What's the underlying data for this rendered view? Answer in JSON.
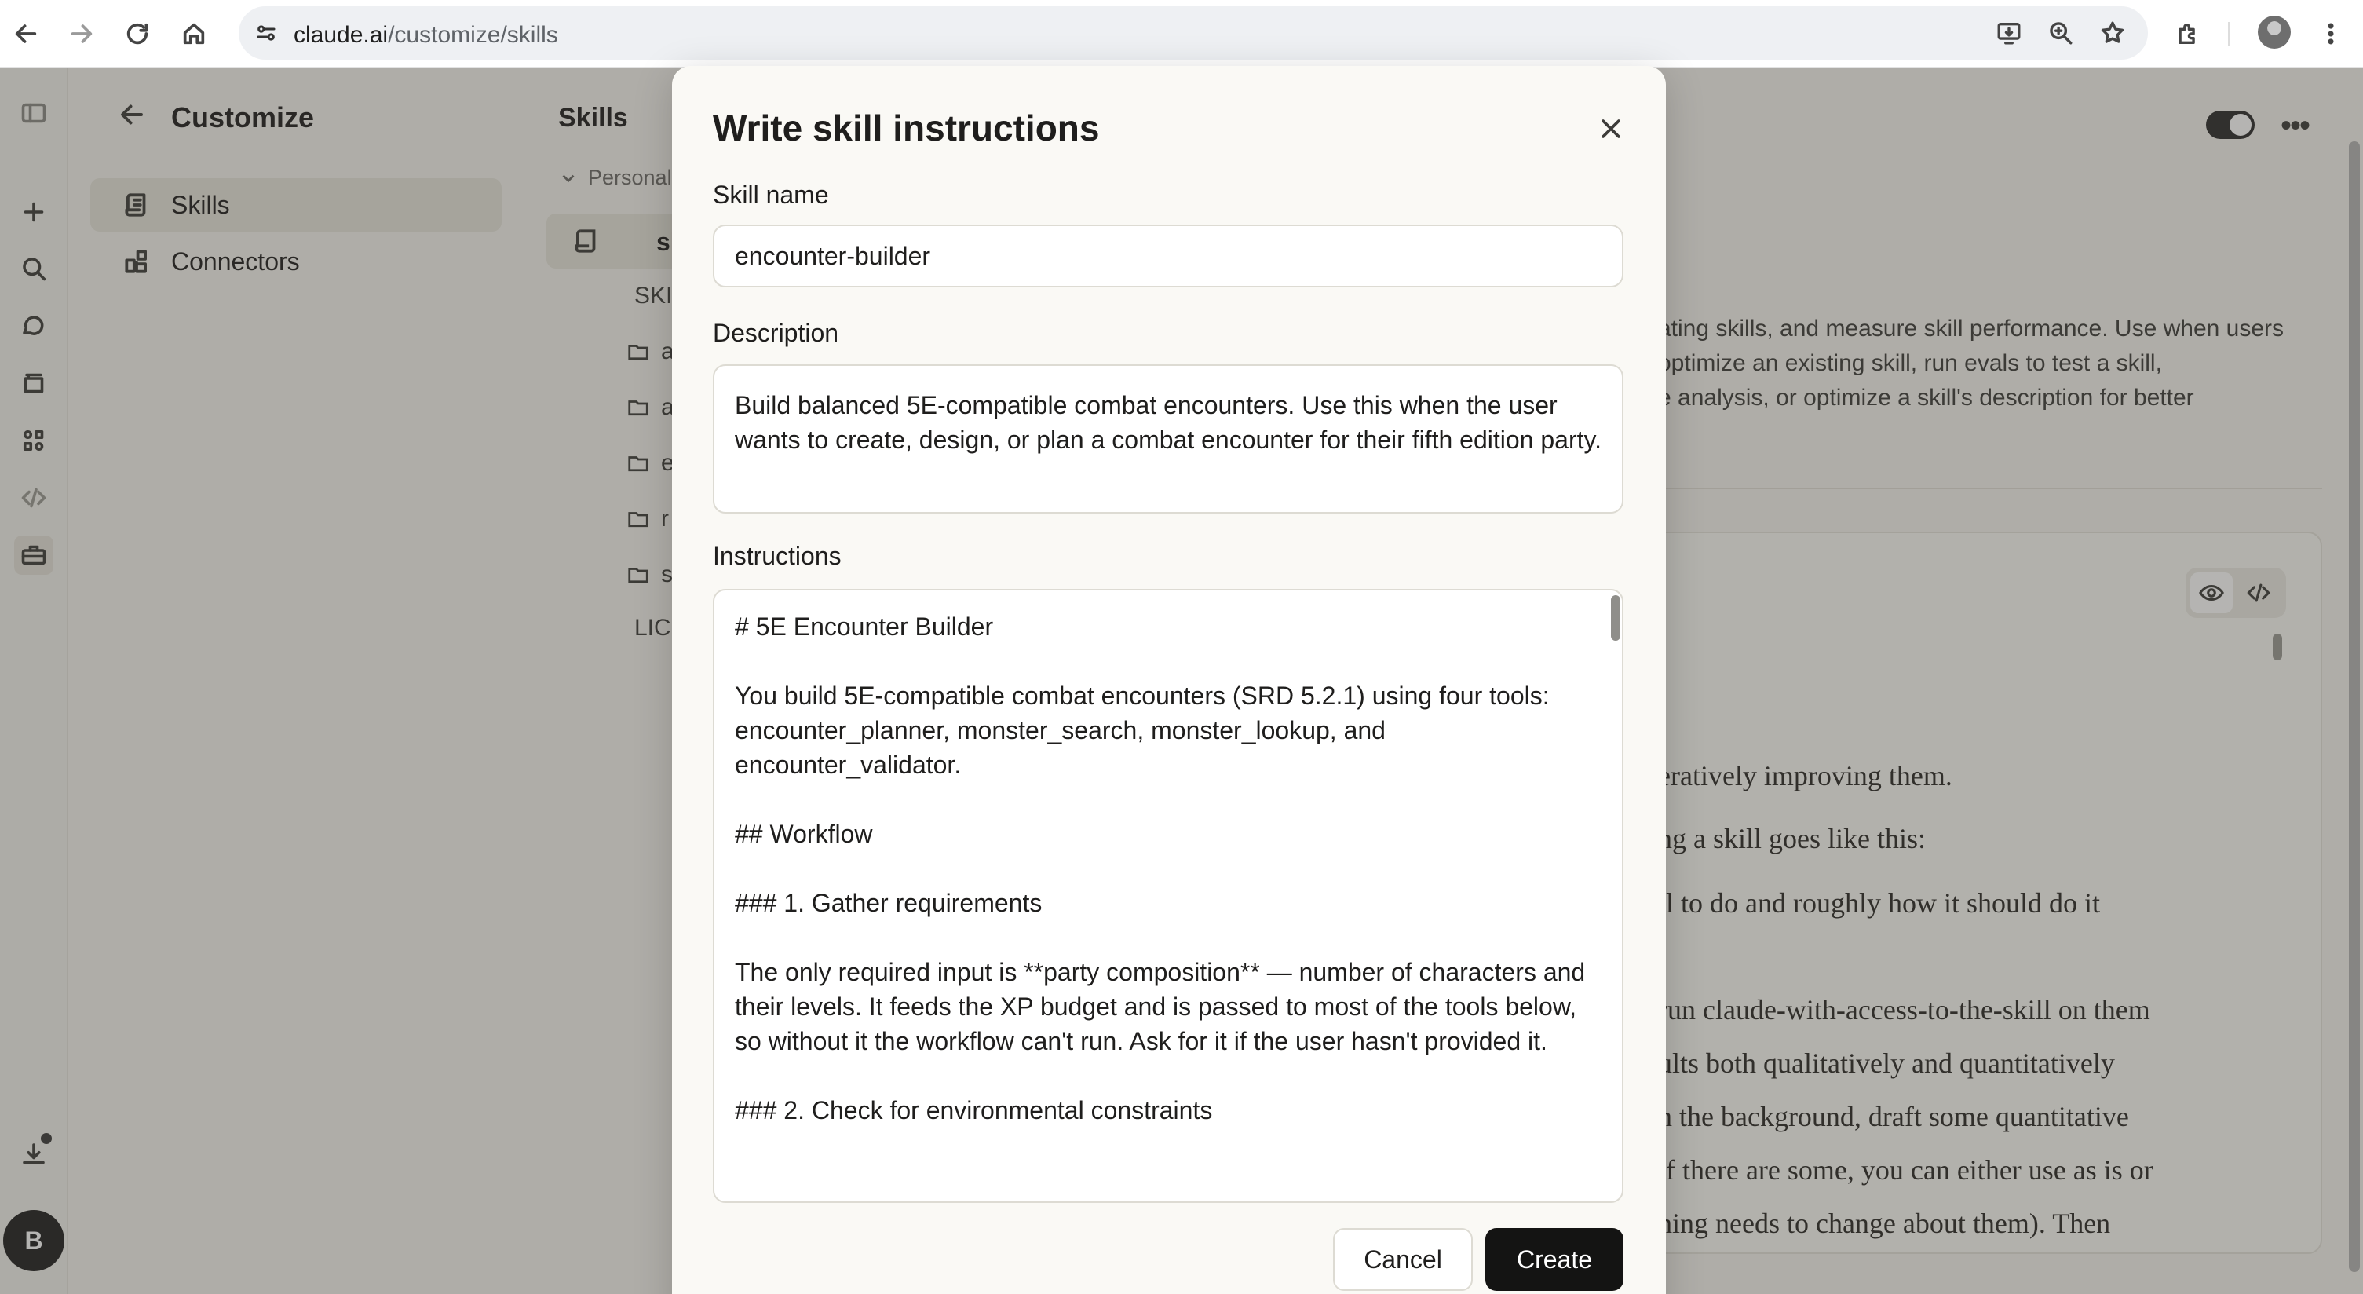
{
  "browser": {
    "url_host": "claude.ai",
    "url_path": "/customize/skills"
  },
  "sidebar": {
    "title": "Customize",
    "items": [
      {
        "label": "Skills",
        "icon": "scroll-icon"
      },
      {
        "label": "Connectors",
        "icon": "connectors-icon"
      }
    ],
    "user_initial": "B"
  },
  "skills_panel": {
    "title": "Skills",
    "group_label": "Personal",
    "selected_skill": "skill",
    "tree": [
      "SKILL",
      "a",
      "a",
      "e",
      "r",
      "s",
      "LIC"
    ]
  },
  "detail": {
    "description_lines": [
      "ating skills, and measure skill performance. Use when users",
      "optimize an existing skill, run evals to test a skill,",
      "e analysis, or optimize a skill's description for better"
    ],
    "content_lines": [
      "eratively improving them.",
      "ng a skill goes like this:",
      "ll to do and roughly how it should do it",
      "run claude-with-access-to-the-skill on them",
      "ults both qualitatively and quantitatively",
      "n the background, draft some quantitative",
      "if there are some, you can either use as is or",
      "hing needs to change about them). Then"
    ]
  },
  "modal": {
    "title": "Write skill instructions",
    "name_label": "Skill name",
    "name_value": "encounter-builder",
    "description_label": "Description",
    "description_value": "Build balanced 5E-compatible combat encounters. Use this when the user wants to create, design, or plan a combat encounter for their fifth edition party.",
    "instructions_label": "Instructions",
    "instructions_value": "# 5E Encounter Builder\n\nYou build 5E-compatible combat encounters (SRD 5.2.1) using four tools: encounter_planner, monster_search, monster_lookup, and encounter_validator.\n\n## Workflow\n\n### 1. Gather requirements\n\nThe only required input is **party composition** — number of characters and their levels. It feeds the XP budget and is passed to most of the tools below, so without it the workflow can't run. Ask for it if the user hasn't provided it.\n\n### 2. Check for environmental constraints",
    "cancel_label": "Cancel",
    "create_label": "Create"
  }
}
